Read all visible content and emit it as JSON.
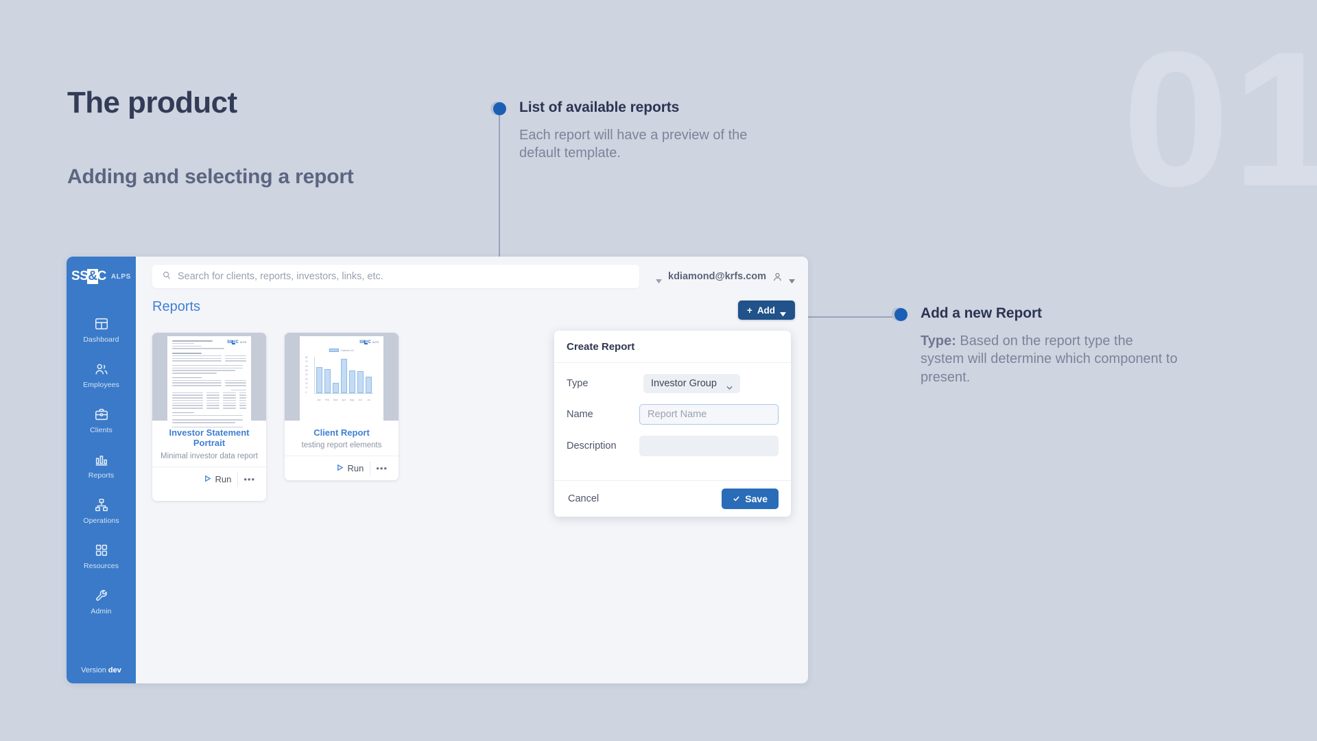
{
  "slide": {
    "number": "01",
    "title": "The product",
    "subtitle": "Adding and selecting a report"
  },
  "callouts": [
    {
      "title": "List of available reports",
      "body": "Each report will have a preview of the default template."
    },
    {
      "title": "Add a new Report",
      "body_lead": "Type:",
      "body": " Based on the report type the system will determine which component to present."
    }
  ],
  "app": {
    "logo": {
      "left": "SS",
      "amp": "&",
      "right": "C",
      "sub": "ALPS"
    },
    "search": {
      "placeholder": "Search for clients, reports, investors, links, etc.",
      "icon": "search-icon"
    },
    "user": {
      "email": "kdiamond@krfs.com",
      "icon": "user-icon",
      "caret": "chevron-down-icon"
    },
    "sidebar": {
      "items": [
        {
          "label": "Dashboard",
          "icon": "dashboard-icon"
        },
        {
          "label": "Employees",
          "icon": "people-icon"
        },
        {
          "label": "Clients",
          "icon": "briefcase-icon"
        },
        {
          "label": "Reports",
          "icon": "bar-chart-icon"
        },
        {
          "label": "Operations",
          "icon": "org-chart-icon"
        },
        {
          "label": "Resources",
          "icon": "grid-icon"
        },
        {
          "label": "Admin",
          "icon": "wrench-icon"
        }
      ],
      "version_label": "Version",
      "version_value": "dev"
    },
    "page_title": "Reports",
    "add_button": {
      "label": "Add",
      "plus": "+",
      "caret": "chevron-down-icon"
    },
    "cards": [
      {
        "title": "Investor Statement Portrait",
        "description": "Minimal investor data report",
        "run_label": "Run",
        "more_label": "•••",
        "thumb_type": "document",
        "thumb_logo": {
          "left": "SS",
          "amp": "&",
          "right": "C",
          "sub": "ALPS"
        }
      },
      {
        "title": "Client Report",
        "description": "testing report elements",
        "run_label": "Run",
        "more_label": "•••",
        "thumb_type": "chart",
        "thumb_logo": {
          "left": "SS",
          "amp": "&",
          "right": "C",
          "sub": "ALPS"
        }
      }
    ],
    "modal": {
      "title": "Create Report",
      "fields": [
        {
          "label": "Type",
          "control": "select",
          "value": "Investor Group"
        },
        {
          "label": "Name",
          "control": "input",
          "value": "Report Name"
        },
        {
          "label": "Description",
          "control": "input",
          "value": ""
        }
      ],
      "cancel_label": "Cancel",
      "save_label": "Save"
    }
  },
  "chart_data": {
    "type": "bar",
    "title": "",
    "categories": [
      "Jan",
      "Feb",
      "Mar",
      "Apr",
      "May",
      "Jun",
      "Jul"
    ],
    "values": [
      58,
      53,
      22,
      76,
      50,
      48,
      36
    ],
    "series": [
      {
        "name": "Dataset #1",
        "values": [
          58,
          53,
          22,
          76,
          50,
          48,
          36
        ]
      }
    ],
    "legend": [
      "Dataset #1"
    ],
    "legend_position": "top",
    "ylabels": [
      "80",
      "70",
      "60",
      "50",
      "40",
      "30",
      "20",
      "10",
      "0"
    ],
    "ylim": [
      0,
      80
    ],
    "xlabel": "",
    "ylabel": "",
    "grid": false
  },
  "colors": {
    "background": "#ced4e0",
    "brand_blue": "#3a7ac8",
    "accent_dot": "#1a5fb4",
    "dark_text": "#333c56",
    "muted_text": "#7b8498",
    "add_button": "#215289",
    "save_button": "#2b6cb8"
  }
}
